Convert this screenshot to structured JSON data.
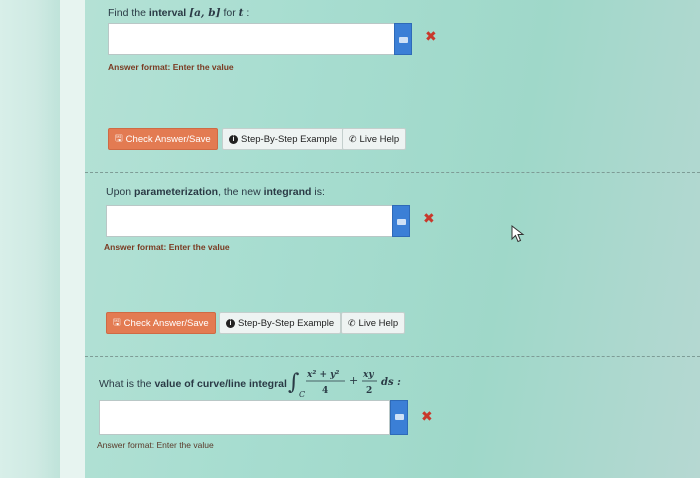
{
  "q1": {
    "prefix": "Find the ",
    "bold": "interval",
    "math": "[a, b]",
    "mid": " for ",
    "var": "t",
    "suffix": " :",
    "answer_value": "",
    "format": "Answer format: Enter the value"
  },
  "buttons1": {
    "check": "Check Answer/Save",
    "step": "Step-By-Step Example",
    "live": "Live Help"
  },
  "q2": {
    "prefix": "Upon ",
    "bold1": "parameterization",
    "mid": ", the new ",
    "bold2": "integrand",
    "suffix": " is:",
    "answer_value": "",
    "format": "Answer format: Enter the value"
  },
  "buttons2": {
    "check": "Check Answer/Save",
    "step": "Step-By-Step Example",
    "live": "Live Help"
  },
  "q3": {
    "prefix": "What is the ",
    "bold": "value of curve/line integral",
    "integral_sub": "C",
    "frac1_num": "x² + y²",
    "frac1_den": "4",
    "plus": "+",
    "frac2_num": "xy",
    "frac2_den": "2",
    "ds": "ds :",
    "answer_value": "",
    "format": "Answer format: Enter the value"
  },
  "icons": {
    "keyboard": "keyboard-icon",
    "clear": "✖",
    "save": "save-icon",
    "info": "info-icon",
    "phone": "phone-icon",
    "cursor": "mouse-cursor"
  },
  "colors": {
    "check_button": "#e37b52",
    "keyboard_button": "#3b7fd6",
    "clear_x": "#c8382b",
    "format_text": "#7a3a22",
    "background": "#a7ddd0"
  }
}
